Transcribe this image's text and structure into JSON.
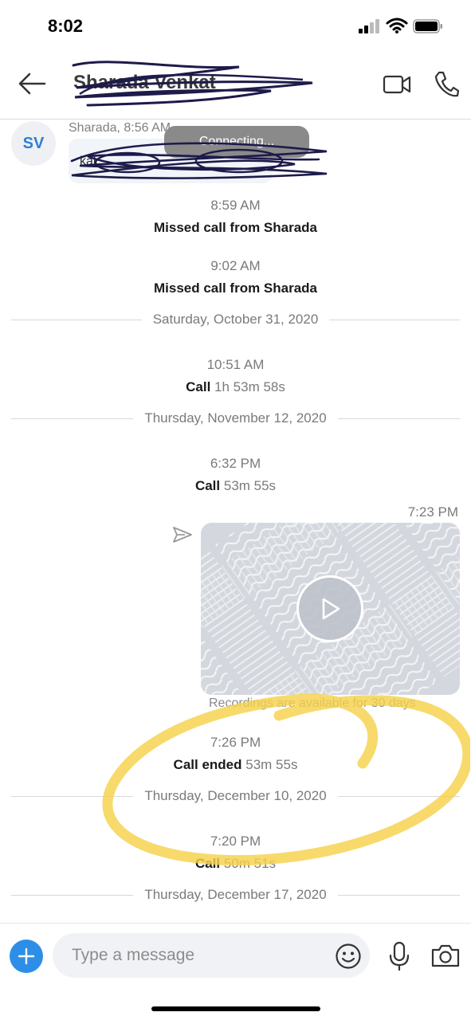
{
  "status_bar": {
    "time": "8:02"
  },
  "header": {
    "contact_name": "Sharada Venkat"
  },
  "chat": {
    "first_message": {
      "avatar_initials": "SV",
      "sender_time": "Sharada, 8:56 AM",
      "text": "kal ... ",
      "overlay": "Connecting..."
    },
    "events": [
      {
        "time": "8:59 AM",
        "bold": "Missed call from Sharada",
        "detail": ""
      },
      {
        "time": "9:02 AM",
        "bold": "Missed call from Sharada",
        "detail": ""
      },
      {
        "time": "10:51 AM",
        "bold": "Call",
        "detail": "1h 53m 58s"
      },
      {
        "time": "6:32 PM",
        "bold": "Call",
        "detail": "53m 55s"
      },
      {
        "time": "7:26 PM",
        "bold": "Call ended",
        "detail": "53m 55s"
      },
      {
        "time": "7:20 PM",
        "bold": "Call",
        "detail": "50m 51s"
      }
    ],
    "date_dividers": [
      "Saturday, October 31, 2020",
      "Thursday, November 12, 2020",
      "Thursday, December 10, 2020",
      "Thursday, December 17, 2020"
    ],
    "recording": {
      "time": "7:23 PM",
      "note": "Recordings are available for 30 days"
    }
  },
  "input": {
    "placeholder": "Type a message"
  },
  "colors": {
    "accent": "#2d8ee8",
    "highlight": "#f5d24a",
    "scribble": "#1d1b4a"
  },
  "icons": [
    "back-arrow-icon",
    "video-call-icon",
    "phone-icon",
    "send-icon",
    "play-icon",
    "plus-icon",
    "emoji-icon",
    "microphone-icon",
    "camera-icon"
  ]
}
